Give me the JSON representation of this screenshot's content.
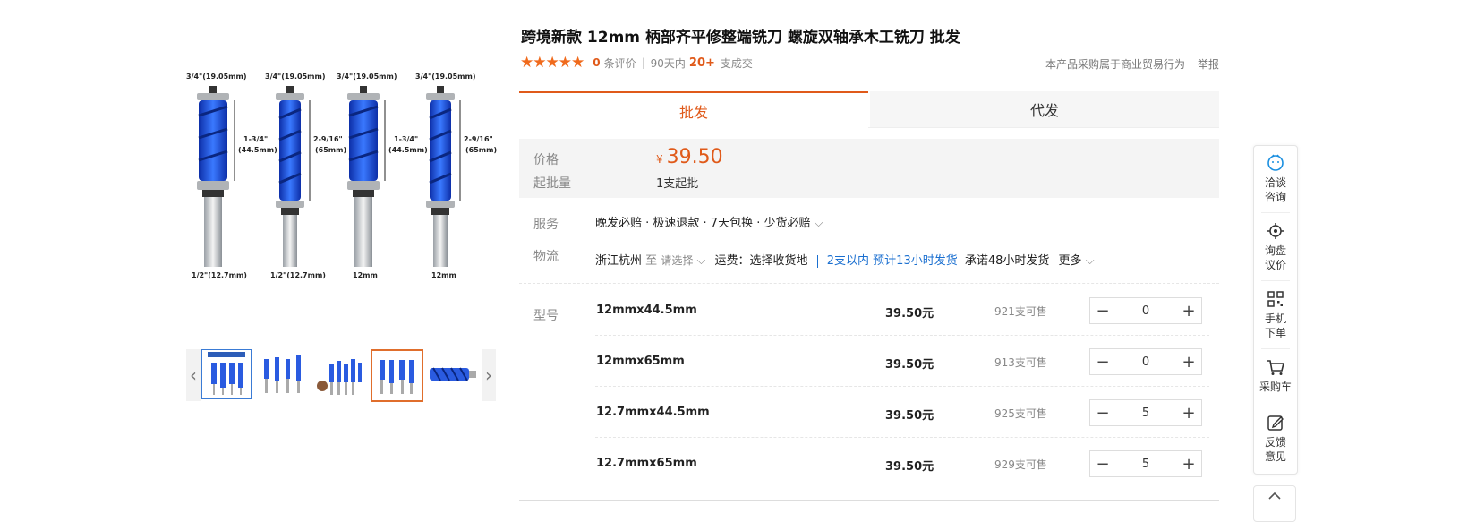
{
  "product": {
    "title": "跨境新款 12mm 柄部齐平修整端铣刀 螺旋双轴承木工铣刀 批发",
    "review_count": "0",
    "review_label": "条评价",
    "sales_prefix": "90天内",
    "sales_count": "20+",
    "sales_suffix": "支成交",
    "commerce_note": "本产品采购属于商业贸易行为",
    "report_label": "举报"
  },
  "image": {
    "bits": [
      {
        "top": "3/4\"(19.05mm)",
        "length": "1-3/4\"\n(44.5mm)",
        "length_l1": "1-3/4\"",
        "length_l2": "(44.5mm)",
        "shank": "1/2\"(12.7mm)"
      },
      {
        "top": "3/4\"(19.05mm)",
        "length_l1": "2-9/16\"",
        "length_l2": "(65mm)",
        "shank": "1/2\"(12.7mm)"
      },
      {
        "top": "3/4\"(19.05mm)",
        "length_l1": "1-3/4\"",
        "length_l2": "(44.5mm)",
        "shank": "12mm"
      },
      {
        "top": "3/4\"(19.05mm)",
        "length_l1": "2-9/16\"",
        "length_l2": "(65mm)",
        "shank": "12mm"
      }
    ],
    "thumb_prev_icon": "chevron-left-icon",
    "thumb_next_icon": "chevron-right-icon"
  },
  "tabs": [
    "批发",
    "代发"
  ],
  "price": {
    "label": "价格",
    "currency": "¥",
    "value": "39.50",
    "moq_label": "起批量",
    "moq_value": "1支起批"
  },
  "service": {
    "label": "服务",
    "value": "晚发必赔 · 极速退款 · 7天包换 · 少货必赔"
  },
  "logistics": {
    "label": "物流",
    "origin": "浙江杭州",
    "to": "至",
    "select": "请选择",
    "freight": "运费：选择收货地",
    "ship_fast": "2支以内 预计13小时发货",
    "promise": "承诺48小时发货",
    "more": "更多"
  },
  "sku": {
    "label": "型号",
    "rows": [
      {
        "name": "12mmx44.5mm",
        "price": "39.50元",
        "stock": "921支可售",
        "qty": "0"
      },
      {
        "name": "12mmx65mm",
        "price": "39.50元",
        "stock": "913支可售",
        "qty": "0"
      },
      {
        "name": "12.7mmx44.5mm",
        "price": "39.50元",
        "stock": "925支可售",
        "qty": "5"
      },
      {
        "name": "12.7mmx65mm",
        "price": "39.50元",
        "stock": "929支可售",
        "qty": "5"
      }
    ]
  },
  "sidebar": {
    "items": [
      {
        "l1": "洽谈",
        "l2": "咨询",
        "icon": "chat-icon"
      },
      {
        "l1": "询盘",
        "l2": "议价",
        "icon": "target-icon"
      },
      {
        "l1": "手机",
        "l2": "下单",
        "icon": "qrcode-icon"
      },
      {
        "l1": "采购车",
        "l2": "",
        "icon": "cart-icon"
      },
      {
        "l1": "反馈",
        "l2": "意见",
        "icon": "edit-icon"
      }
    ]
  },
  "colors": {
    "accent": "#e05a1a",
    "link": "#1a6fd0",
    "bit_blue": "#1f4fd8"
  }
}
